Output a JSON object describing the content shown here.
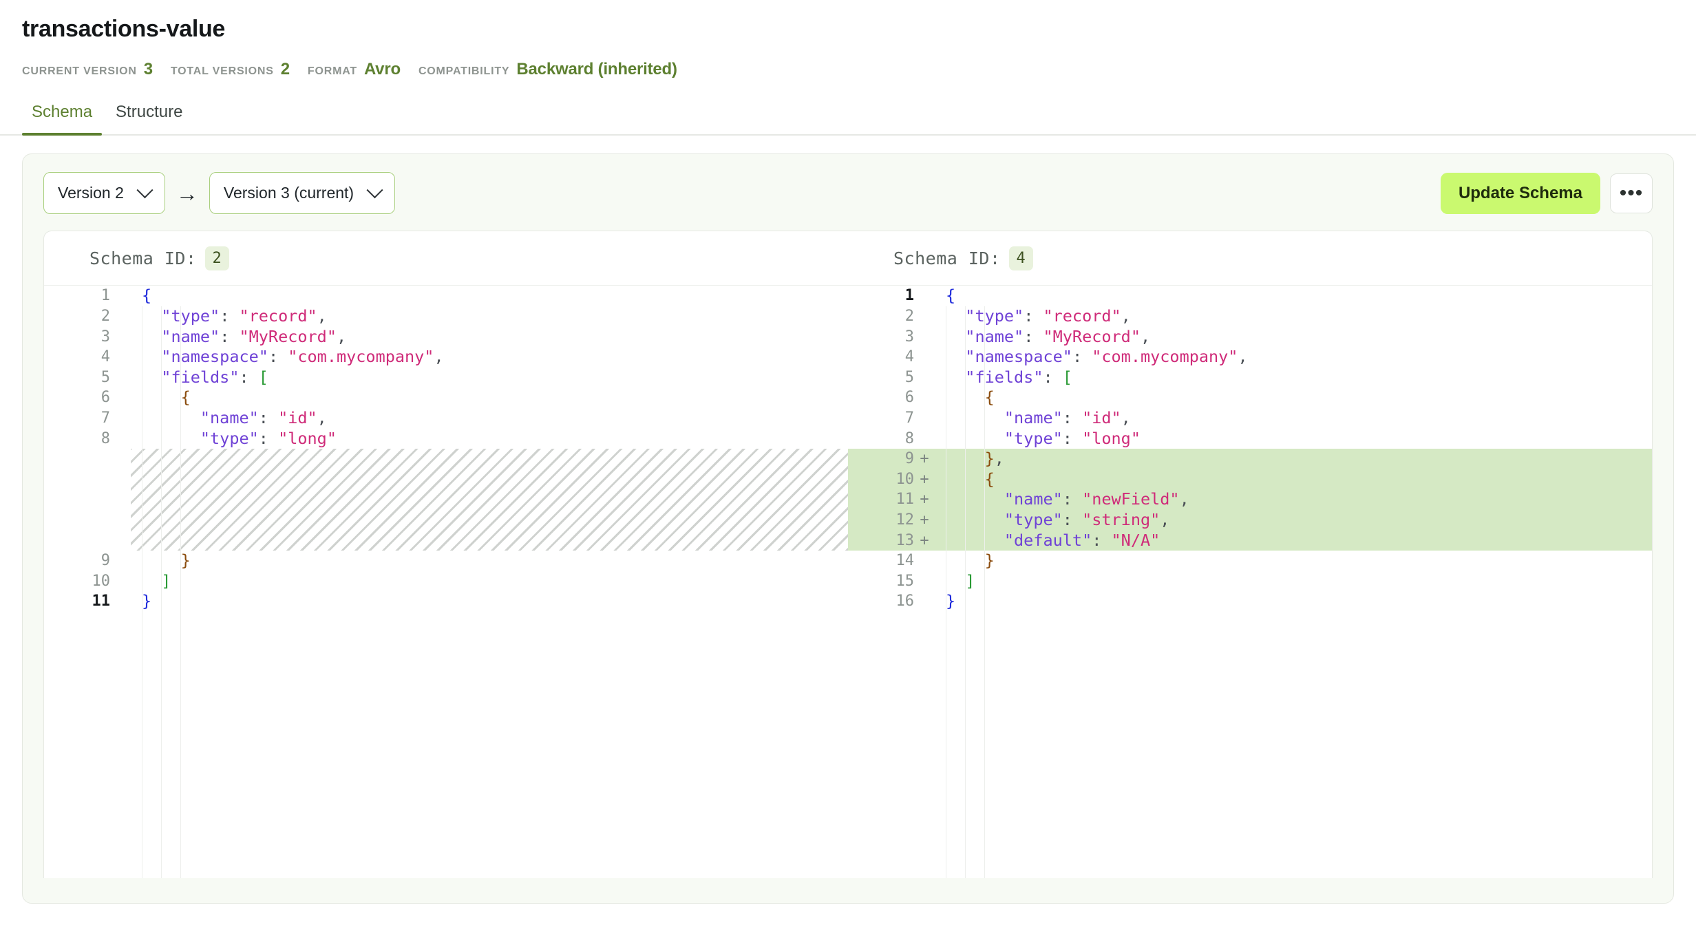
{
  "header": {
    "title": "transactions-value",
    "meta": [
      {
        "label": "CURRENT VERSION",
        "value": "3"
      },
      {
        "label": "TOTAL VERSIONS",
        "value": "2"
      },
      {
        "label": "FORMAT",
        "value": "Avro"
      },
      {
        "label": "COMPATIBILITY",
        "value": "Backward (inherited)"
      }
    ]
  },
  "tabs": [
    {
      "label": "Schema",
      "active": true
    },
    {
      "label": "Structure",
      "active": false
    }
  ],
  "toolbar": {
    "from_version": "Version 2",
    "to_version": "Version 3 (current)",
    "arrow": "→",
    "update_label": "Update Schema",
    "more_label": "•••"
  },
  "left_pane": {
    "schema_id_label": "Schema ID:",
    "schema_id": "2",
    "lines": [
      {
        "num": "1",
        "marker": "",
        "indent": 0,
        "tokens": [
          {
            "c": "t-brace1",
            "t": "{"
          }
        ]
      },
      {
        "num": "2",
        "marker": "",
        "indent": 1,
        "tokens": [
          {
            "c": "t-key",
            "t": "\"type\""
          },
          {
            "c": "t-punc",
            "t": ": "
          },
          {
            "c": "t-str",
            "t": "\"record\""
          },
          {
            "c": "t-punc",
            "t": ","
          }
        ]
      },
      {
        "num": "3",
        "marker": "",
        "indent": 1,
        "tokens": [
          {
            "c": "t-key",
            "t": "\"name\""
          },
          {
            "c": "t-punc",
            "t": ": "
          },
          {
            "c": "t-str",
            "t": "\"MyRecord\""
          },
          {
            "c": "t-punc",
            "t": ","
          }
        ]
      },
      {
        "num": "4",
        "marker": "",
        "indent": 1,
        "tokens": [
          {
            "c": "t-key",
            "t": "\"namespace\""
          },
          {
            "c": "t-punc",
            "t": ": "
          },
          {
            "c": "t-str",
            "t": "\"com.mycompany\""
          },
          {
            "c": "t-punc",
            "t": ","
          }
        ]
      },
      {
        "num": "5",
        "marker": "",
        "indent": 1,
        "tokens": [
          {
            "c": "t-key",
            "t": "\"fields\""
          },
          {
            "c": "t-punc",
            "t": ": "
          },
          {
            "c": "t-bracket",
            "t": "["
          }
        ]
      },
      {
        "num": "6",
        "marker": "",
        "indent": 2,
        "tokens": [
          {
            "c": "t-brace2",
            "t": "{"
          }
        ]
      },
      {
        "num": "7",
        "marker": "",
        "indent": 3,
        "tokens": [
          {
            "c": "t-key",
            "t": "\"name\""
          },
          {
            "c": "t-punc",
            "t": ": "
          },
          {
            "c": "t-str",
            "t": "\"id\""
          },
          {
            "c": "t-punc",
            "t": ","
          }
        ]
      },
      {
        "num": "8",
        "marker": "",
        "indent": 3,
        "tokens": [
          {
            "c": "t-key",
            "t": "\"type\""
          },
          {
            "c": "t-punc",
            "t": ": "
          },
          {
            "c": "t-str",
            "t": "\"long\""
          }
        ]
      },
      {
        "num": "9",
        "marker": "",
        "indent": 2,
        "tokens": [
          {
            "c": "t-brace2",
            "t": "}"
          }
        ]
      },
      {
        "num": "10",
        "marker": "",
        "indent": 1,
        "tokens": [
          {
            "c": "t-bracket",
            "t": "]"
          }
        ]
      },
      {
        "num": "11",
        "marker": "",
        "indent": 0,
        "bold": true,
        "tokens": [
          {
            "c": "t-brace1",
            "t": "}"
          }
        ]
      }
    ],
    "placeholder_after_line": "8"
  },
  "right_pane": {
    "schema_id_label": "Schema ID:",
    "schema_id": "4",
    "lines": [
      {
        "num": "1",
        "marker": "",
        "indent": 0,
        "bold": true,
        "tokens": [
          {
            "c": "t-brace1",
            "t": "{"
          }
        ]
      },
      {
        "num": "2",
        "marker": "",
        "indent": 1,
        "tokens": [
          {
            "c": "t-key",
            "t": "\"type\""
          },
          {
            "c": "t-punc",
            "t": ": "
          },
          {
            "c": "t-str",
            "t": "\"record\""
          },
          {
            "c": "t-punc",
            "t": ","
          }
        ]
      },
      {
        "num": "3",
        "marker": "",
        "indent": 1,
        "tokens": [
          {
            "c": "t-key",
            "t": "\"name\""
          },
          {
            "c": "t-punc",
            "t": ": "
          },
          {
            "c": "t-str",
            "t": "\"MyRecord\""
          },
          {
            "c": "t-punc",
            "t": ","
          }
        ]
      },
      {
        "num": "4",
        "marker": "",
        "indent": 1,
        "tokens": [
          {
            "c": "t-key",
            "t": "\"namespace\""
          },
          {
            "c": "t-punc",
            "t": ": "
          },
          {
            "c": "t-str",
            "t": "\"com.mycompany\""
          },
          {
            "c": "t-punc",
            "t": ","
          }
        ]
      },
      {
        "num": "5",
        "marker": "",
        "indent": 1,
        "tokens": [
          {
            "c": "t-key",
            "t": "\"fields\""
          },
          {
            "c": "t-punc",
            "t": ": "
          },
          {
            "c": "t-bracket",
            "t": "["
          }
        ]
      },
      {
        "num": "6",
        "marker": "",
        "indent": 2,
        "tokens": [
          {
            "c": "t-brace2",
            "t": "{"
          }
        ]
      },
      {
        "num": "7",
        "marker": "",
        "indent": 3,
        "tokens": [
          {
            "c": "t-key",
            "t": "\"name\""
          },
          {
            "c": "t-punc",
            "t": ": "
          },
          {
            "c": "t-str",
            "t": "\"id\""
          },
          {
            "c": "t-punc",
            "t": ","
          }
        ]
      },
      {
        "num": "8",
        "marker": "",
        "indent": 3,
        "tokens": [
          {
            "c": "t-key",
            "t": "\"type\""
          },
          {
            "c": "t-punc",
            "t": ": "
          },
          {
            "c": "t-str",
            "t": "\"long\""
          }
        ]
      },
      {
        "num": "9",
        "marker": "+",
        "added": true,
        "indent": 2,
        "tokens": [
          {
            "c": "t-brace2",
            "t": "}"
          },
          {
            "c": "t-punc",
            "t": ","
          }
        ]
      },
      {
        "num": "10",
        "marker": "+",
        "added": true,
        "indent": 2,
        "tokens": [
          {
            "c": "t-brace2",
            "t": "{"
          }
        ]
      },
      {
        "num": "11",
        "marker": "+",
        "added": true,
        "indent": 3,
        "tokens": [
          {
            "c": "t-key",
            "t": "\"name\""
          },
          {
            "c": "t-punc",
            "t": ": "
          },
          {
            "c": "t-str",
            "t": "\"newField\""
          },
          {
            "c": "t-punc",
            "t": ","
          }
        ]
      },
      {
        "num": "12",
        "marker": "+",
        "added": true,
        "indent": 3,
        "tokens": [
          {
            "c": "t-key",
            "t": "\"type\""
          },
          {
            "c": "t-punc",
            "t": ": "
          },
          {
            "c": "t-str",
            "t": "\"string\""
          },
          {
            "c": "t-punc",
            "t": ","
          }
        ]
      },
      {
        "num": "13",
        "marker": "+",
        "added": true,
        "indent": 3,
        "tokens": [
          {
            "c": "t-key",
            "t": "\"default\""
          },
          {
            "c": "t-punc",
            "t": ": "
          },
          {
            "c": "t-str",
            "t": "\"N/A\""
          }
        ]
      },
      {
        "num": "14",
        "marker": "",
        "indent": 2,
        "tokens": [
          {
            "c": "t-brace2",
            "t": "}"
          }
        ]
      },
      {
        "num": "15",
        "marker": "",
        "indent": 1,
        "tokens": [
          {
            "c": "t-bracket",
            "t": "]"
          }
        ]
      },
      {
        "num": "16",
        "marker": "",
        "indent": 0,
        "tokens": [
          {
            "c": "t-brace1",
            "t": "}"
          }
        ]
      }
    ]
  },
  "colors": {
    "accent_green": "#5d8030",
    "button_green": "#caf96f",
    "diff_added_bg": "#d5e9c4",
    "badge_bg": "#e9f2dd",
    "card_bg": "#f7faf4"
  }
}
